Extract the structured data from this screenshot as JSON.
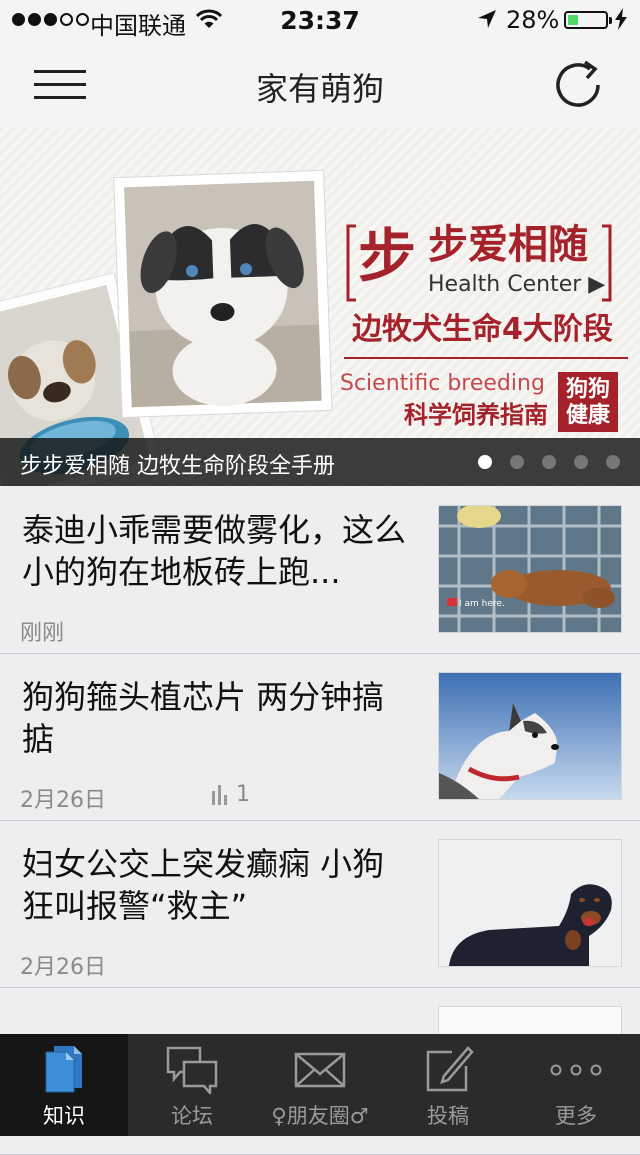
{
  "status_bar": {
    "carrier": "中国联通",
    "time": "23:37",
    "battery_percent": "28%",
    "battery_level": 0.28
  },
  "navbar": {
    "title": "家有萌狗"
  },
  "banner": {
    "headline": "步步爱相随",
    "subtitle_en": "Health Center",
    "line2": "边牧犬生命4大阶段",
    "line3_en": "Scientific breeding",
    "line4": "科学饲养指南",
    "stamp_line1": "狗狗",
    "stamp_line2": "健康",
    "caption": "步步爱相随 边牧生命阶段全手册",
    "page_count": 5,
    "active_page": 1
  },
  "feed": [
    {
      "title": "泰迪小乖需要做雾化，这么小的狗在地板砖上跑...",
      "date": "刚刚",
      "views": null,
      "thumb": "toy-poodle-on-plaid-sofa",
      "thumb_caption": "I am here."
    },
    {
      "title": "狗狗箍头植芯片 两分钟搞掂",
      "date": "2月26日",
      "views": "1",
      "thumb": "husky-against-sky"
    },
    {
      "title": "妇女公交上突发癫痫 小狗狂叫报警“救主”",
      "date": "2月26日",
      "views": null,
      "thumb": "rottweiler-on-white"
    },
    {
      "title": "",
      "date": "",
      "views": null,
      "thumb": "dog-partially-visible"
    }
  ],
  "tabbar": [
    {
      "label": "知识",
      "icon": "documents-icon",
      "active": true
    },
    {
      "label": "论坛",
      "icon": "chat-bubbles-icon",
      "active": false
    },
    {
      "label": "♀朋友圈♂",
      "icon": "envelope-icon",
      "active": false
    },
    {
      "label": "投稿",
      "icon": "compose-icon",
      "active": false
    },
    {
      "label": "更多",
      "icon": "more-dots-icon",
      "active": false
    }
  ],
  "colors": {
    "battery_green": "#4cd964",
    "banner_red": "#a5222a",
    "tabbar_bg": "#2b2b2b",
    "tab_active_icon": "#3d8fd9"
  }
}
